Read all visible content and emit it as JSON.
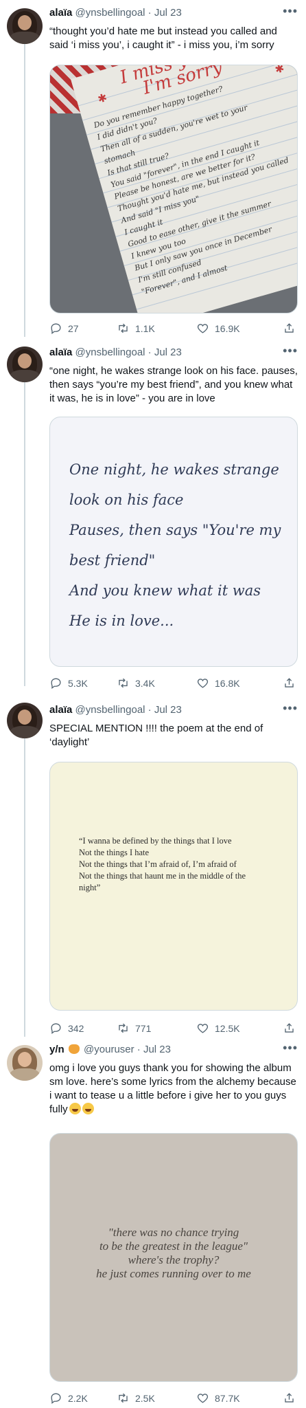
{
  "tweets": [
    {
      "name": "alaïa",
      "handle": "@ynsbellingoal",
      "date": "Jul 23",
      "text": "“thought you’d hate me but instead you called and said ‘i miss you’, i caught it” - i miss you, i’m sorry",
      "image": {
        "title1": "I miss you,",
        "title2": "I'm sorry",
        "lines": [
          "Do you remember happy together?",
          "I did didn't you?",
          "Then all of a sudden, you're wet to your",
          "stomach",
          "Is that still true?",
          "You said \"forever\", in the end I caught it",
          "Please be honest, are we better for it?",
          "Thought you'd hate me, but instead you called",
          "And said \"I miss you\"",
          "I caught it",
          "Good to ease other, give it the summer",
          "I knew you too",
          "But I only saw you once in December",
          "I'm still confused",
          "\"Forever\", and I almost"
        ]
      },
      "replies": "27",
      "retweets": "1.1K",
      "likes": "16.9K"
    },
    {
      "name": "alaïa",
      "handle": "@ynsbellingoal",
      "date": "Jul 23",
      "text": "“one night, he wakes strange look on his face. pauses, then says “you’re my best friend”, and you knew what it was, he is in love” - you are in love",
      "image": {
        "lines": [
          "One night, he wakes strange",
          "look on his face",
          "Pauses, then says \"You're my",
          "best friend\"",
          "And you knew what it was",
          "He is in love..."
        ]
      },
      "replies": "5.3K",
      "retweets": "3.4K",
      "likes": "16.8K"
    },
    {
      "name": "alaïa",
      "handle": "@ynsbellingoal",
      "date": "Jul 23",
      "text": "SPECIAL MENTION !!!! the poem at the end of ‘daylight’",
      "image": {
        "lines": [
          "“I wanna be defined by the things that I love",
          "Not the things I hate",
          "Not the things that I’m afraid of, I’m afraid of",
          "Not the things that haunt me in the middle of the",
          "night”"
        ]
      },
      "replies": "342",
      "retweets": "771",
      "likes": "12.5K"
    },
    {
      "name": "y/n",
      "handle": "@youruser",
      "date": "Jul 23",
      "text": "omg i love you guys thank you for showing the album sm love. here’s some lyrics from the alchemy because i want to tease u a little before i give her to you guys fully",
      "image": {
        "lines": [
          "\"there was no chance trying",
          "to be the greatest in the league\"",
          "where's the trophy?",
          "he just comes running over to me"
        ]
      },
      "replies": "2.2K",
      "retweets": "2.5K",
      "likes": "87.7K"
    }
  ],
  "icons": {
    "more": "more-horizontal-icon",
    "reply": "reply-icon",
    "retweet": "retweet-icon",
    "like": "heart-icon",
    "share": "share-icon"
  },
  "colors": {
    "text": "#0f1419",
    "secondary": "#536471",
    "border": "#cfd9de"
  }
}
